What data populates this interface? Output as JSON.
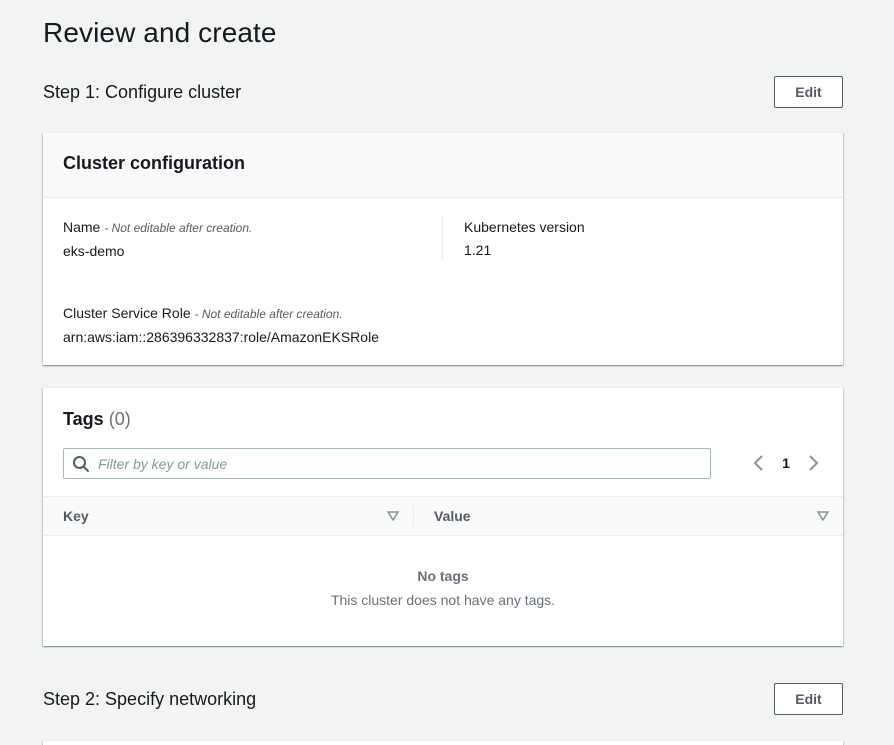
{
  "page": {
    "title": "Review and create"
  },
  "step1": {
    "title": "Step 1: Configure cluster",
    "edit_label": "Edit"
  },
  "cluster_config": {
    "header": "Cluster configuration",
    "name": {
      "label": "Name",
      "hint": "- Not editable after creation.",
      "value": "eks-demo"
    },
    "k8s_version": {
      "label": "Kubernetes version",
      "value": "1.21"
    },
    "service_role": {
      "label": "Cluster Service Role",
      "hint": "- Not editable after creation.",
      "value": "arn:aws:iam::286396332837:role/AmazonEKSRole"
    }
  },
  "tags": {
    "title": "Tags",
    "count": "(0)",
    "search_placeholder": "Filter by key or value",
    "page_number": "1",
    "columns": [
      "Key",
      "Value"
    ],
    "empty_title": "No tags",
    "empty_description": "This cluster does not have any tags."
  },
  "step2": {
    "title": "Step 2: Specify networking",
    "edit_label": "Edit"
  },
  "colors": {
    "background": "#f2f3f3",
    "text": "#16191f",
    "muted": "#687078",
    "border": "#545b64"
  }
}
